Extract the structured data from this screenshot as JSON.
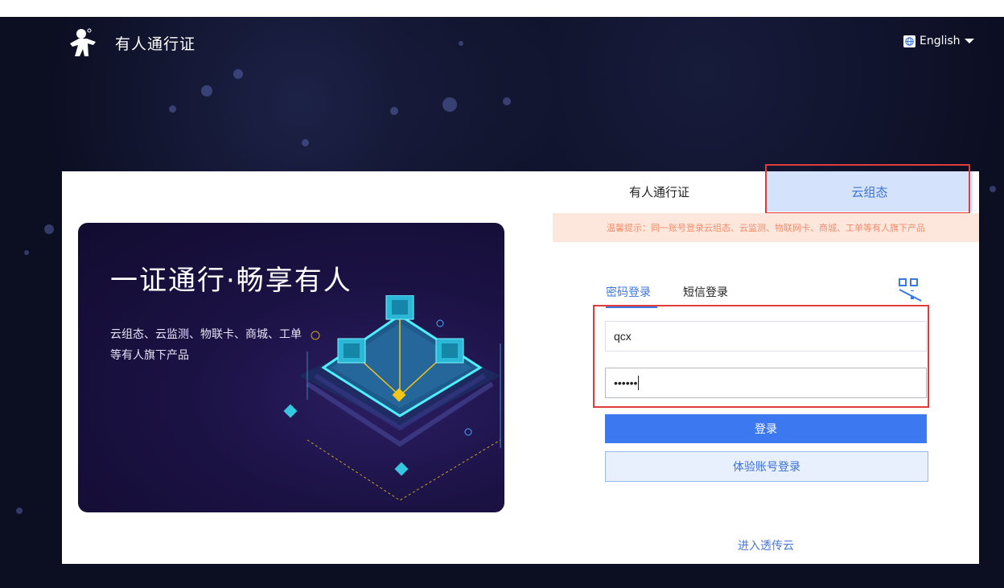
{
  "header": {
    "brand": "有人通行证",
    "language": "English"
  },
  "promo": {
    "title": "一证通行·畅享有人",
    "description": "云组态、云监测、物联卡、商城、工单等有人旗下产品"
  },
  "tabs": [
    {
      "label": "有人通行证",
      "selected": false
    },
    {
      "label": "云组态",
      "selected": true
    }
  ],
  "notice": "温馨提示：同一账号登录云组态、云监测、物联网卡、商城、工单等有人旗下产品",
  "login_modes": [
    {
      "label": "密码登录",
      "active": true
    },
    {
      "label": "短信登录",
      "active": false
    }
  ],
  "form": {
    "username_value": "qcx",
    "password_value": "••••••"
  },
  "buttons": {
    "login": "登录",
    "demo": "体验账号登录"
  },
  "footer_link": "进入透传云",
  "colors": {
    "accent": "#3c78f0",
    "highlight": "#e23b3b",
    "notice_bg": "#fde7dc",
    "notice_text": "#f28d6b",
    "background": "#0c0e22"
  },
  "icons": [
    "logo-icon",
    "globe-icon",
    "qr-code-icon"
  ]
}
